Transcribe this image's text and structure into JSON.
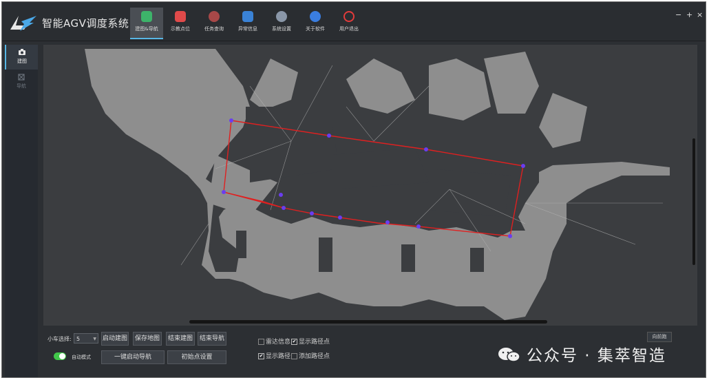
{
  "app": {
    "title": "智能AGV调度系统"
  },
  "nav": [
    {
      "label": "建图&导航",
      "icon": "shield-check-icon",
      "color": "#3db36a",
      "active": true
    },
    {
      "label": "示教点位",
      "icon": "cube-icon",
      "color": "#e04a4a"
    },
    {
      "label": "任务查询",
      "icon": "search-icon",
      "color": "#d85a5a"
    },
    {
      "label": "异常信息",
      "icon": "board-icon",
      "color": "#3a82d6"
    },
    {
      "label": "系统设置",
      "icon": "gear-icon",
      "color": "#8a97a8"
    },
    {
      "label": "关于软件",
      "icon": "accessibility-icon",
      "color": "#3a7de0"
    },
    {
      "label": "用户退出",
      "icon": "power-icon",
      "color": "#e23b3b"
    }
  ],
  "window_controls": {
    "minimize": "−",
    "maximize": "+",
    "close": "×"
  },
  "sidebar": [
    {
      "label": "建图",
      "icon": "camera-icon",
      "active": true
    },
    {
      "label": "导航",
      "icon": "navigate-icon",
      "active": false
    }
  ],
  "controls": {
    "car_select_label": "小车选择:",
    "car_select_value": "5",
    "auto_mode_label": "自动模式",
    "auto_mode_on": true,
    "buttons": {
      "start_mapping": "启动建图",
      "save_map": "保存地图",
      "end_mapping": "结束建图",
      "end_navigation": "结束导航",
      "one_key_start_nav": "一键启动导航",
      "initial_point_setup": "初始点设置"
    },
    "checkboxes": {
      "radar_info": {
        "label": "雷达信息",
        "checked": false
      },
      "show_path_points": {
        "label": "显示路径点",
        "checked": true
      },
      "show_path": {
        "label": "显示路径",
        "checked": true
      },
      "add_path_points": {
        "label": "添加路径点",
        "checked": false
      }
    },
    "corner_button": "向前跑"
  },
  "watermark": {
    "text": "公众号 · 集萃智造",
    "icon": "wechat-icon"
  },
  "colors": {
    "path": "#e02020",
    "waypoint": "#6a3df0",
    "map_free": "#8e8e8e",
    "map_bg": "#3b3d40",
    "accent": "#58b7e6"
  }
}
